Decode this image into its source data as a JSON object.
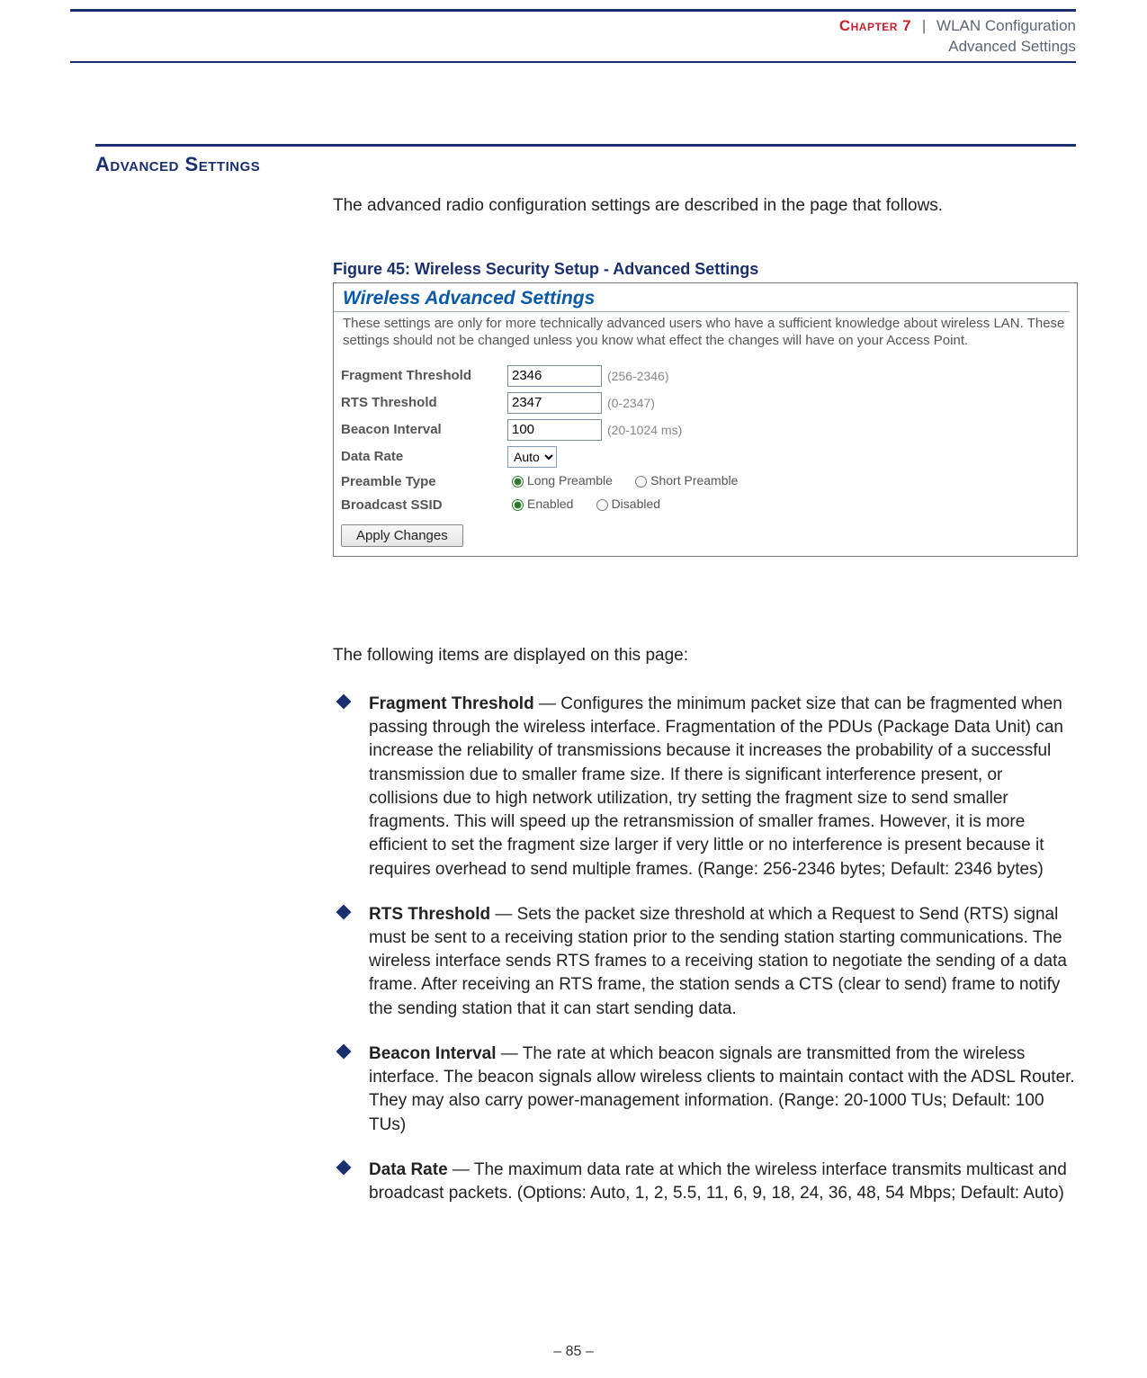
{
  "header": {
    "chapter": "Chapter 7",
    "separator": "|",
    "title": "WLAN Configuration",
    "subtitle": "Advanced Settings"
  },
  "section_title": "Advanced Settings",
  "intro": "The advanced radio configuration settings are described in the page that follows.",
  "figure_caption": "Figure 45:  Wireless Security Setup - Advanced Settings",
  "panel": {
    "title": "Wireless Advanced Settings",
    "description": "These settings are only for more technically advanced users who have a sufficient knowledge about wireless LAN. These settings should not be changed unless you know what effect the changes will have on your Access Point.",
    "rows": {
      "fragment": {
        "label": "Fragment Threshold",
        "value": "2346",
        "range": "(256-2346)"
      },
      "rts": {
        "label": "RTS Threshold",
        "value": "2347",
        "range": "(0-2347)"
      },
      "beacon": {
        "label": "Beacon Interval",
        "value": "100",
        "range": "(20-1024 ms)"
      },
      "datarate": {
        "label": "Data Rate",
        "value": "Auto"
      },
      "preamble": {
        "label": "Preamble Type",
        "opt1": "Long Preamble",
        "opt2": "Short Preamble",
        "selected": "long"
      },
      "bssid": {
        "label": "Broadcast SSID",
        "opt1": "Enabled",
        "opt2": "Disabled",
        "selected": "enabled"
      }
    },
    "apply_label": "Apply Changes"
  },
  "items_intro": "The following items are displayed on this page:",
  "bullets": [
    {
      "term": "Fragment Threshold",
      "text": " — Configures the minimum packet size that can be fragmented when passing through the wireless interface. Fragmentation of the PDUs (Package Data Unit) can increase the reliability of transmissions because it increases the probability of a successful transmission due to smaller frame size. If there is significant interference present, or collisions due to high network utilization, try setting the fragment size to send smaller fragments. This will speed up the retransmission of smaller frames. However, it is more efficient to set the fragment size larger if very little or no interference is present because it requires overhead to send multiple frames. (Range: 256-2346 bytes; Default: 2346 bytes)"
    },
    {
      "term": "RTS Threshold",
      "text": " — Sets the packet size threshold at which a Request to Send (RTS) signal must be sent to a receiving station prior to the sending station starting communications. The wireless interface sends RTS frames to a receiving station to negotiate the sending of a data frame. After receiving an RTS frame, the station sends a CTS (clear to send) frame to notify the sending station that it can start sending data."
    },
    {
      "term": "Beacon Interval",
      "text": " — The rate at which beacon signals are transmitted from the wireless interface. The beacon signals allow wireless clients to maintain contact with the ADSL Router. They may also carry power-management information. (Range: 20-1000 TUs; Default: 100 TUs)"
    },
    {
      "term": "Data Rate",
      "text": " — The maximum data rate at which the wireless interface transmits multicast and broadcast packets. (Options: Auto, 1, 2, 5.5, 11, 6, 9, 18, 24, 36, 48, 54 Mbps; Default: Auto)"
    }
  ],
  "footer": "–  85  –"
}
